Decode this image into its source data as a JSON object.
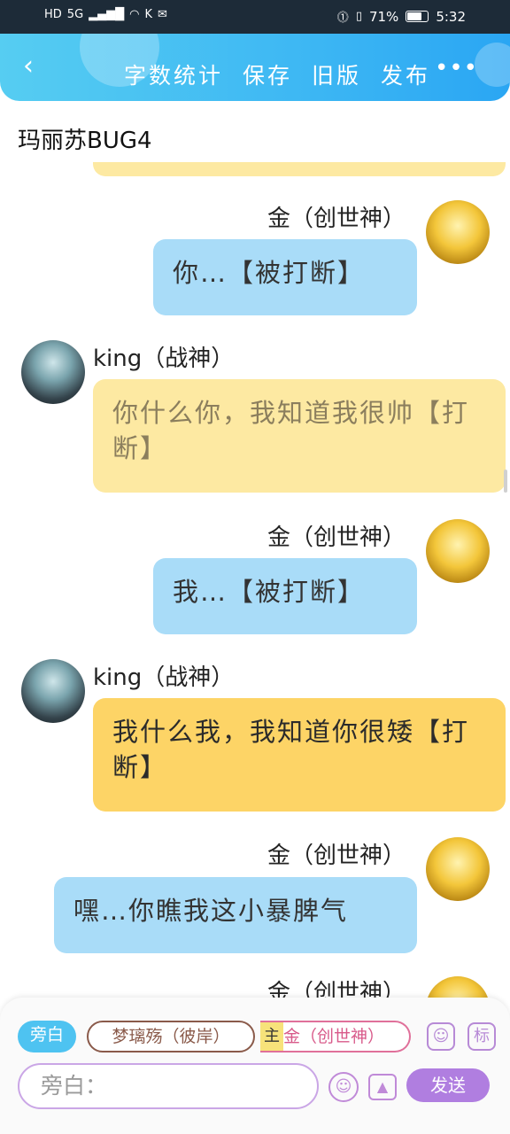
{
  "status_bar": {
    "left_icons": [
      "HD",
      "5G",
      "signal-icon",
      "wifi-icon",
      "K",
      "wechat-icon"
    ],
    "battery_percent": "71%",
    "battery_level": 0.71,
    "time": "5:32"
  },
  "header": {
    "back_icon": "chevron-left-icon",
    "actions": [
      "字数统计",
      "保存",
      "旧版",
      "发布"
    ],
    "more_icon": "more-dots-icon",
    "more_label": "•••"
  },
  "page_title": "玛丽苏BUG4",
  "messages": [
    {
      "speaker": "金（创世神）",
      "side": "right",
      "style": "blue",
      "text": "你…【被打断】"
    },
    {
      "speaker": "king（战神）",
      "side": "left",
      "style": "yellow-light",
      "text": "你什么你，我知道我很帅【打断】"
    },
    {
      "speaker": "金（创世神）",
      "side": "right",
      "style": "blue",
      "text": "我…【被打断】"
    },
    {
      "speaker": "king（战神）",
      "side": "left",
      "style": "yellow",
      "text": "我什么我，我知道你很矮【打断】"
    },
    {
      "speaker": "金（创世神）",
      "side": "right",
      "style": "blue",
      "text": "嘿…你瞧我这小暴脾气"
    },
    {
      "speaker": "金（创世神）",
      "side": "right",
      "style": "blue",
      "text": ""
    }
  ],
  "composer": {
    "narration_chip": "旁白",
    "role_chips": [
      "梦璃殇（彼岸）",
      "金（创世神）"
    ],
    "main_tag": "主",
    "input_placeholder": "旁白：",
    "send_label": "发送",
    "side_icons": [
      "person-card-icon",
      "tag-icon"
    ],
    "tag_label": "标",
    "emoji_icon": "emoji-icon",
    "image_icon": "image-icon"
  },
  "colors": {
    "header_start": "#56cdf2",
    "header_end": "#2aa6f3",
    "blue_bubble": "#a9dcf8",
    "yellow_bubble": "#fdd466",
    "yellow_light_bubble": "#fde9a2",
    "accent_purple": "#b07ee0"
  }
}
